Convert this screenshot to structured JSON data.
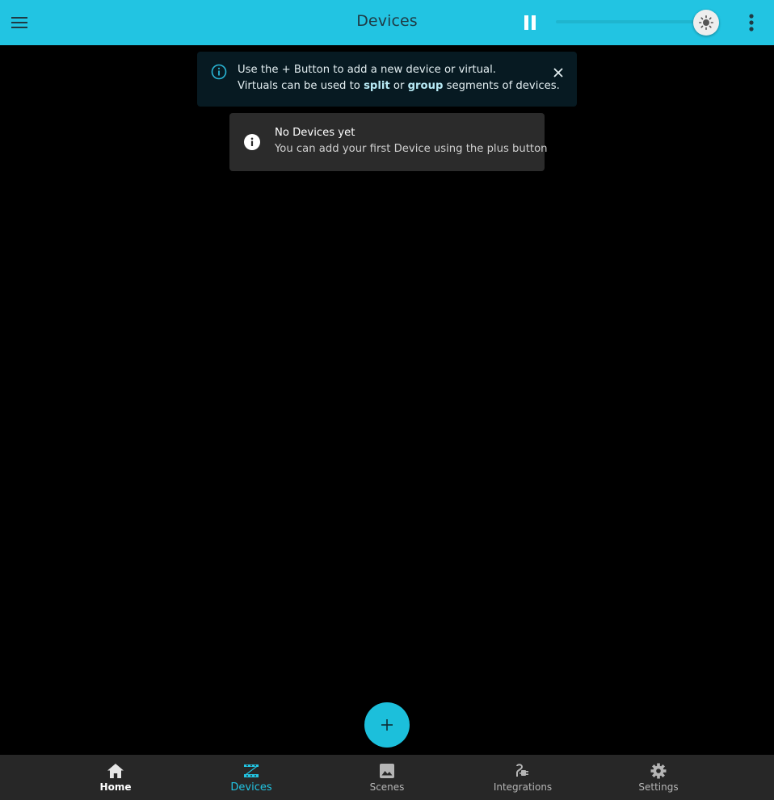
{
  "app": {
    "title": "Devices"
  },
  "info_banner": {
    "line1": "Use the + Button to add a new device or virtual.",
    "line2_prefix": "Virtuals can be used to ",
    "line2_split": "split",
    "line2_or": " or ",
    "line2_group": "group",
    "line2_suffix": " segments of devices."
  },
  "empty_state": {
    "title": "No Devices yet",
    "subtitle": "You can add your first Device using the plus button"
  },
  "bottom_nav": {
    "items": [
      {
        "label": "Home",
        "icon": "home-icon"
      },
      {
        "label": "Devices",
        "icon": "devices-icon"
      },
      {
        "label": "Scenes",
        "icon": "image-icon"
      },
      {
        "label": "Integrations",
        "icon": "integrations-icon"
      },
      {
        "label": "Settings",
        "icon": "gear-icon"
      }
    ]
  },
  "colors": {
    "accent": "#22c4e2",
    "background": "#000000",
    "banner_bg": "#071a22",
    "card_bg": "#2b2b2b",
    "nav_bg": "#272727"
  }
}
